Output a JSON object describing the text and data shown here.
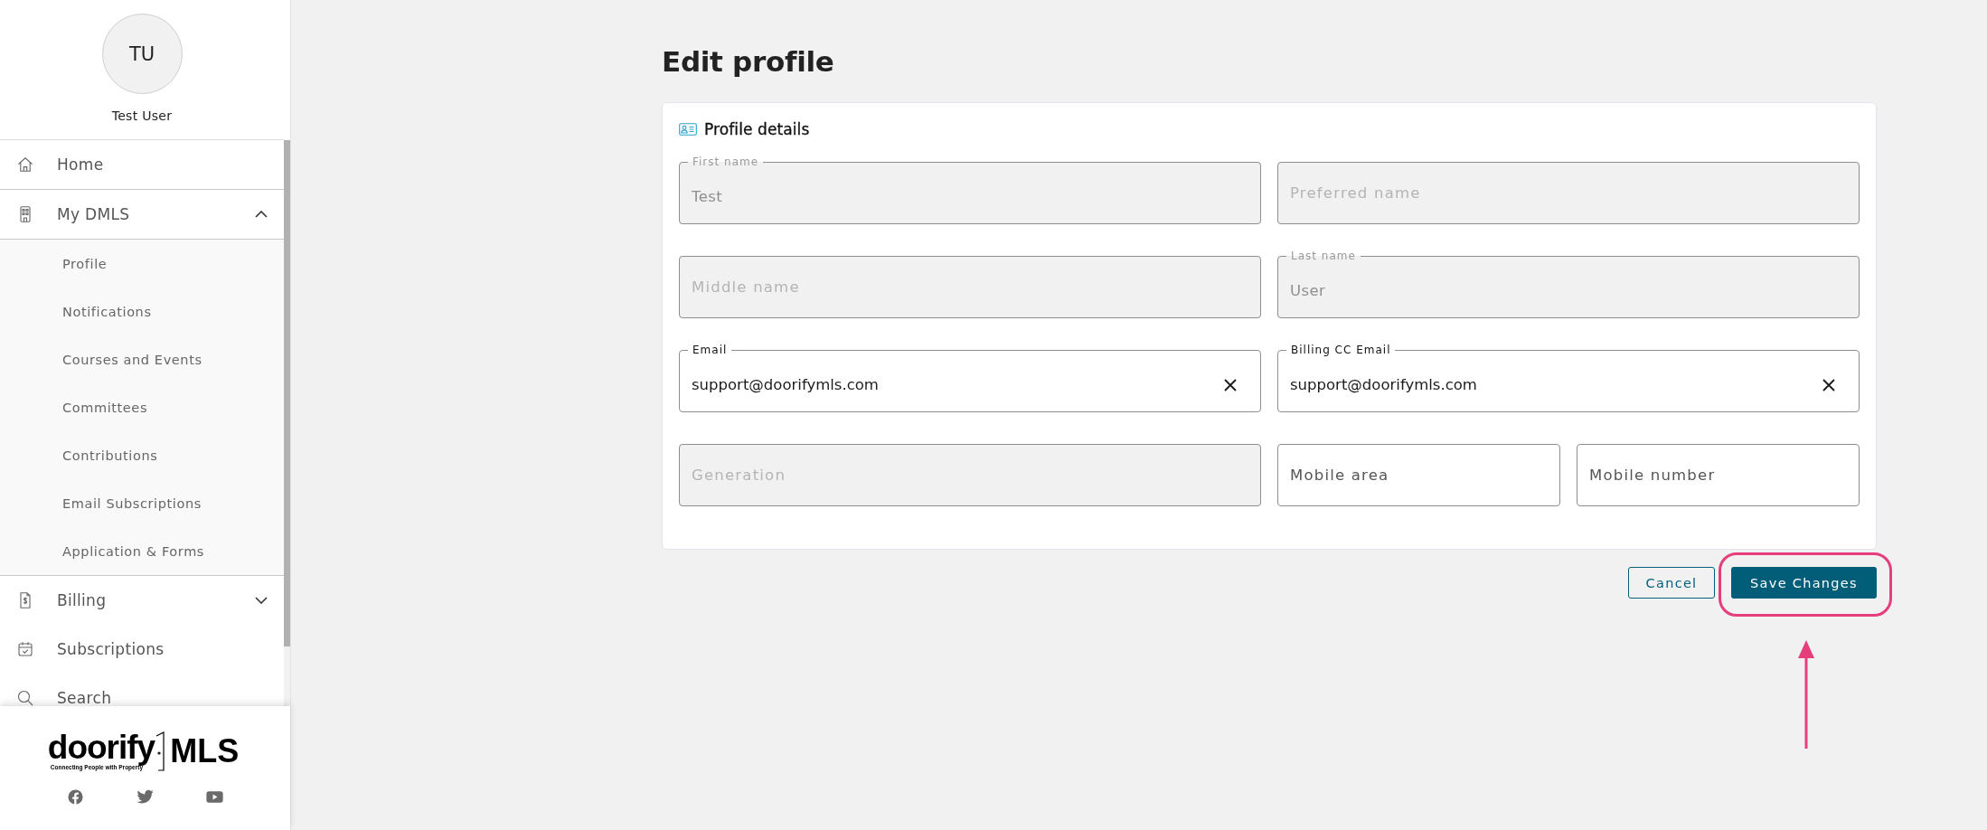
{
  "sidebar": {
    "user": {
      "initials": "TU",
      "name": "Test User"
    },
    "nav": [
      {
        "kind": "link",
        "label": "Home"
      },
      {
        "kind": "group",
        "label": "My DMLS",
        "expanded": true,
        "children": [
          {
            "label": "Profile"
          },
          {
            "label": "Notifications"
          },
          {
            "label": "Courses and Events"
          },
          {
            "label": "Committees"
          },
          {
            "label": "Contributions"
          },
          {
            "label": "Email Subscriptions"
          },
          {
            "label": "Application & Forms"
          }
        ]
      },
      {
        "kind": "group",
        "label": "Billing",
        "expanded": false
      },
      {
        "kind": "link",
        "label": "Subscriptions"
      },
      {
        "kind": "link",
        "label": "Search"
      }
    ],
    "brand": {
      "name": "doorify",
      "suffix": "MLS",
      "tagline": "Connecting People with Property"
    }
  },
  "page": {
    "title": "Edit profile"
  },
  "profile_card": {
    "title": "Profile details",
    "rows": [
      [
        {
          "label": "First name",
          "value": "Test",
          "disabled": true,
          "clearable": false
        },
        {
          "placeholder": "Preferred name",
          "disabled": true,
          "clearable": false
        }
      ],
      [
        {
          "placeholder": "Middle name",
          "disabled": true,
          "clearable": false
        },
        {
          "label": "Last name",
          "value": "User",
          "disabled": true,
          "clearable": false
        }
      ],
      [
        {
          "label": "Email",
          "value": "support@doorifymls.com",
          "disabled": false,
          "clearable": true
        },
        {
          "label": "Billing CC Email",
          "value": "support@doorifymls.com",
          "disabled": false,
          "clearable": true
        }
      ],
      [
        {
          "placeholder": "Generation",
          "disabled": true,
          "clearable": false
        },
        {
          "placeholder": "Mobile area",
          "disabled": false,
          "clearable": false
        },
        {
          "placeholder": "Mobile number",
          "disabled": false,
          "clearable": false
        }
      ]
    ]
  },
  "actions": [
    {
      "kind": "secondary",
      "label": "Cancel"
    },
    {
      "kind": "primary",
      "label": "Save Changes"
    }
  ]
}
